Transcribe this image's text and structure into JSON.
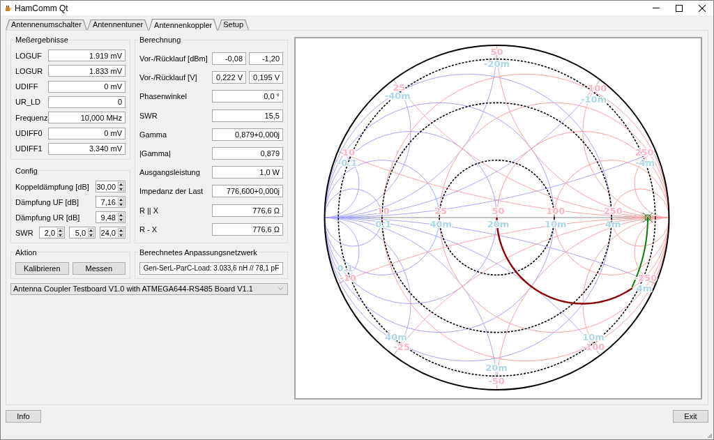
{
  "window": {
    "title": "HamComm Qt"
  },
  "tabs": [
    {
      "label": "Antennenumschalter",
      "selected": false
    },
    {
      "label": "Antennentuner",
      "selected": false
    },
    {
      "label": "Antennenkoppler",
      "selected": true
    },
    {
      "label": "Setup",
      "selected": false
    }
  ],
  "measurements": {
    "title": "Meßergebnisse",
    "rows": [
      {
        "label": "LOGUF",
        "value": "1.919 mV"
      },
      {
        "label": "LOGUR",
        "value": "1.833 mV"
      },
      {
        "label": "UDIFF",
        "value": "0 mV"
      },
      {
        "label": "UR_LD",
        "value": "0"
      },
      {
        "label": "Frequenz",
        "value": "10,000 MHz"
      },
      {
        "label": "UDIFF0",
        "value": "0 mV"
      },
      {
        "label": "UDIFF1",
        "value": "3.340 mV"
      }
    ]
  },
  "config": {
    "title": "Config",
    "rows": [
      {
        "label": "Koppeldämpfung [dB]",
        "values": [
          "30,00"
        ]
      },
      {
        "label": "Dämpfung UF [dB]",
        "values": [
          "7,16"
        ]
      },
      {
        "label": "Dämpfung UR [dB]",
        "values": [
          "9,48"
        ]
      },
      {
        "label": "SWR",
        "values": [
          "2,0",
          "5,0",
          "24,0"
        ]
      }
    ]
  },
  "calculation": {
    "title": "Berechnung",
    "rows": [
      {
        "label": "Vor-/Rücklauf [dBm]",
        "values": [
          "-0,08",
          "-1,20"
        ]
      },
      {
        "label": "Vor-/Rücklauf [V]",
        "values": [
          "0,222 V",
          "0,195 V"
        ]
      },
      {
        "label": "Phasenwinkel",
        "values": [
          "0,0 °"
        ]
      },
      {
        "label": "SWR",
        "values": [
          "15,5"
        ]
      },
      {
        "label": "Gamma",
        "values": [
          "0,879+0,000j"
        ]
      },
      {
        "label": "|Gamma|",
        "values": [
          "0,879"
        ]
      },
      {
        "label": "Ausgangsleistung",
        "values": [
          "1,0 W"
        ]
      },
      {
        "label": "Impedanz der Last",
        "values": [
          "776,600+0,000j"
        ]
      },
      {
        "label": "R || X",
        "values": [
          "776,6 Ω"
        ]
      },
      {
        "label": "R - X",
        "values": [
          "776,6 Ω"
        ]
      }
    ]
  },
  "action": {
    "title": "Aktion",
    "buttons": [
      "Kalibrieren",
      "Messen"
    ]
  },
  "matching_network": {
    "title": "Berechnetes Anpassungsnetzwerk",
    "value": "Gen-SerL-ParC-Load: 3.033,6 nH // 78,1 pF"
  },
  "board_select": {
    "value": "Antenna Coupler Testboard V1.0 with ATMEGA644-RS485 Board V1.1"
  },
  "smith_chart": {
    "axis_labels": [
      {
        "resistance": "10",
        "conductance": "0.1"
      },
      {
        "resistance": "25",
        "conductance": "40m"
      },
      {
        "resistance": "50",
        "conductance": "20m"
      },
      {
        "resistance": "100",
        "conductance": "10m"
      },
      {
        "resistance": "250",
        "conductance": "4m"
      }
    ],
    "upper_rim_labels": [
      {
        "reactance": "10",
        "susceptance": "-0.1"
      },
      {
        "reactance": "25",
        "susceptance": "-40m"
      },
      {
        "reactance": "50",
        "susceptance": "-20m"
      },
      {
        "reactance": "100",
        "susceptance": "-10m"
      },
      {
        "reactance": "250",
        "susceptance": "-4m"
      }
    ],
    "lower_rim_labels": [
      {
        "reactance": "-10",
        "susceptance": "0.1"
      },
      {
        "reactance": "-25",
        "susceptance": "40m"
      },
      {
        "reactance": "-50",
        "susceptance": "20m"
      },
      {
        "reactance": "-100",
        "susceptance": "10m"
      },
      {
        "reactance": "-250",
        "susceptance": "4m"
      }
    ]
  },
  "footer": {
    "buttons": [
      "Info",
      "Exit"
    ]
  }
}
